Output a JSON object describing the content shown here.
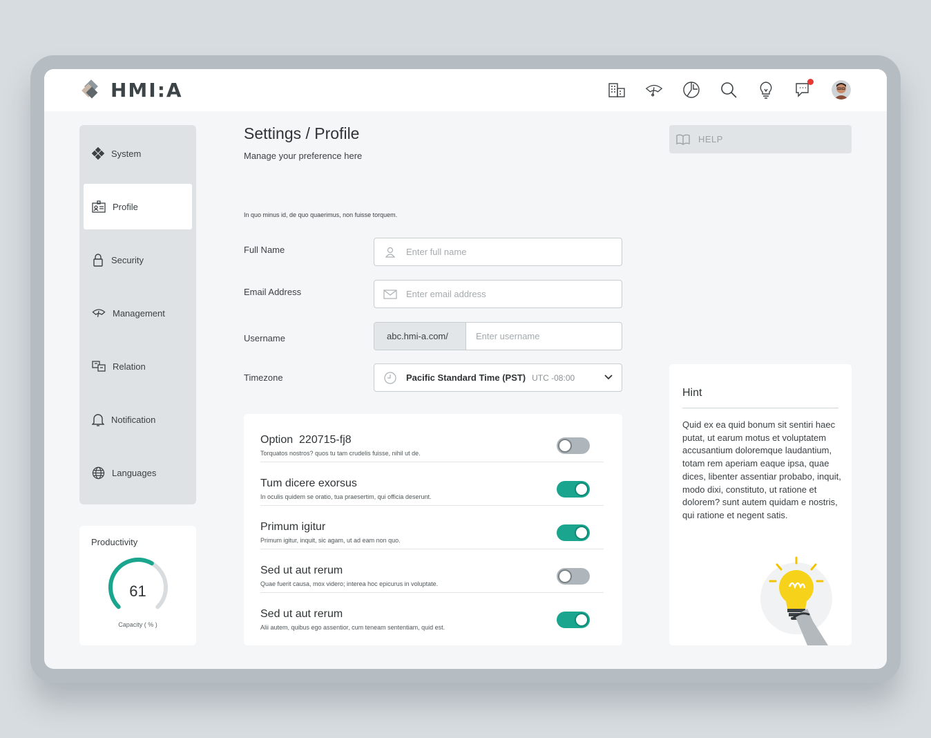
{
  "app": {
    "logo_text": "HMI:A"
  },
  "topbar": {
    "icons": [
      "building-icon",
      "gauge-icon",
      "chart-pie-icon",
      "search-icon",
      "lightbulb-icon",
      "chat-icon",
      "avatar"
    ]
  },
  "sidebar": {
    "items": [
      {
        "label": "System",
        "icon": "system-icon"
      },
      {
        "label": "Profile",
        "icon": "profile-card-icon",
        "active": true
      },
      {
        "label": "Security",
        "icon": "lock-icon"
      },
      {
        "label": "Management",
        "icon": "gauge-icon"
      },
      {
        "label": "Relation",
        "icon": "relation-icon"
      },
      {
        "label": "Notification",
        "icon": "bell-icon"
      },
      {
        "label": "Languages",
        "icon": "globe-icon"
      }
    ]
  },
  "productivity": {
    "title": "Productivity",
    "value": "61",
    "percent": 61,
    "caption": "Capacity ( % )",
    "accent": "#1aa58f"
  },
  "page": {
    "title": "Settings / Profile",
    "subtitle": "Manage your preference here",
    "intro": "In quo minus id, de quo quaerimus, non fuisse torquem."
  },
  "form": {
    "full_name": {
      "label": "Full Name",
      "placeholder": "Enter full name",
      "value": ""
    },
    "email": {
      "label": "Email Address",
      "placeholder": "Enter email address",
      "value": ""
    },
    "username": {
      "label": "Username",
      "prefix": "abc.hmi-a.com/",
      "placeholder": "Enter username",
      "value": ""
    },
    "timezone": {
      "label": "Timezone",
      "selected": "Pacific Standard Time (PST)",
      "offset": "UTC -08:00"
    }
  },
  "options": [
    {
      "title": "Option  220715-fj8",
      "desc": "Torquatos nostros? quos tu tam crudelis fuisse, nihil ut de.",
      "enabled": false
    },
    {
      "title": "Tum dicere exorsus",
      "desc": "In oculis quidem se oratio, tua praesertim, qui officia deserunt.",
      "enabled": true
    },
    {
      "title": "Primum igitur",
      "desc": "Primum igitur, inquit, sic agam, ut ad eam non quo.",
      "enabled": true
    },
    {
      "title": "Sed ut aut rerum",
      "desc": "Quae fuerit causa, mox videro; interea hoc epicurus in voluptate.",
      "enabled": false
    },
    {
      "title": "Sed ut aut rerum",
      "desc": "Alii autem, quibus ego assentior, cum teneam sententiam, quid est.",
      "enabled": true
    }
  ],
  "help": {
    "label": "HELP"
  },
  "hint": {
    "title": "Hint",
    "body": "Quid ex ea quid bonum sit sentiri haec putat, ut earum motus et voluptatem accusantium doloremque laudantium, totam rem aperiam eaque ipsa, quae dices, libenter assentiar probabo, inquit, modo dixi, constituto, ut ratione et dolorem? sunt autem quidam e nostris, qui ratione et negent satis."
  }
}
